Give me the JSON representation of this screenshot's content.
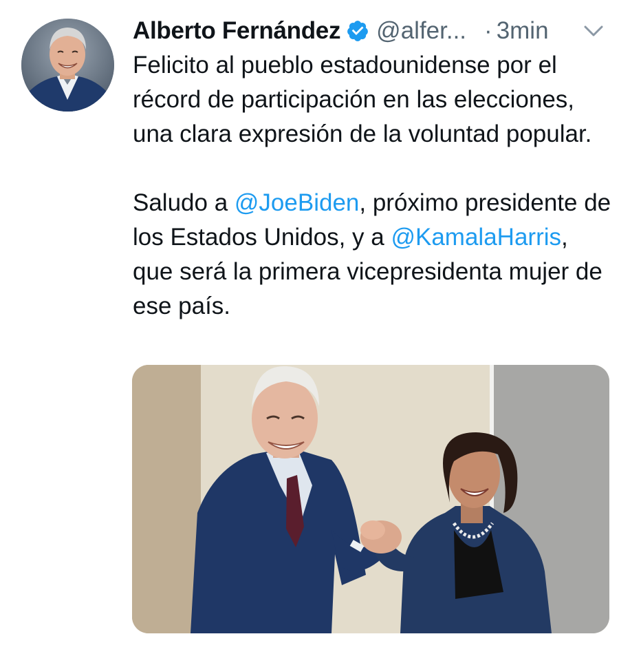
{
  "author": {
    "display_name": "Alberto Fernández",
    "handle": "@alfer...",
    "separator": "·",
    "timestamp": "3min",
    "avatar_icon": "profile-photo",
    "verified_icon": "verified-badge-icon",
    "verified_color": "#1d9bf0"
  },
  "menu": {
    "icon": "chevron-down-icon"
  },
  "body": {
    "paragraph1": "Felicito al pueblo estadounidense por el récord de participación en las elecciones, una clara expresión de la voluntad popular.",
    "p2_part1": "Saludo a ",
    "p2_mention1": "@JoeBiden",
    "p2_part2": ", próximo presidente de los Estados Unidos, y a ",
    "p2_mention2": "@KamalaHarris",
    "p2_part3": ", que será la primera vicepresidenta mujer de ese país."
  },
  "colors": {
    "text": "#0f1419",
    "secondary": "#536471",
    "link": "#1d9bf0"
  },
  "media": {
    "icon": "photo-image"
  }
}
